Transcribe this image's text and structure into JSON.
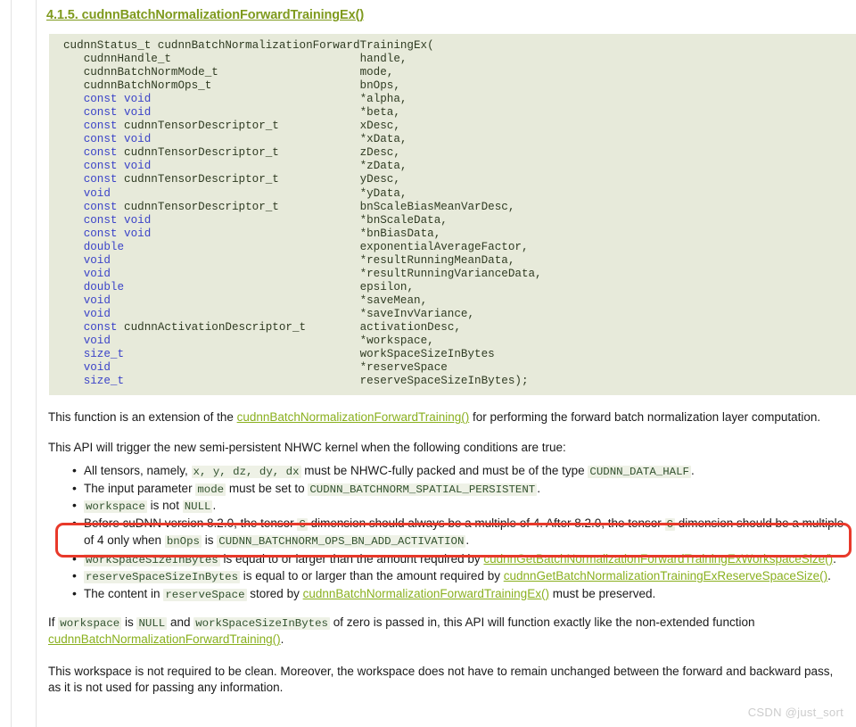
{
  "heading": "4.1.5. cudnnBatchNormalizationForwardTrainingEx()",
  "code": {
    "signature": "cudnnStatus_t cudnnBatchNormalizationForwardTrainingEx(",
    "params": [
      {
        "type_kw": "",
        "type": "cudnnHandle_t",
        "name": "handle,"
      },
      {
        "type_kw": "",
        "type": "cudnnBatchNormMode_t",
        "name": "mode,"
      },
      {
        "type_kw": "",
        "type": "cudnnBatchNormOps_t",
        "name": "bnOps,"
      },
      {
        "type_kw": "const ",
        "type": "void",
        "name": "*alpha,",
        "type_is_kw": true
      },
      {
        "type_kw": "const ",
        "type": "void",
        "name": "*beta,",
        "type_is_kw": true
      },
      {
        "type_kw": "const ",
        "type": "cudnnTensorDescriptor_t",
        "name": "xDesc,"
      },
      {
        "type_kw": "const ",
        "type": "void",
        "name": "*xData,",
        "type_is_kw": true
      },
      {
        "type_kw": "const ",
        "type": "cudnnTensorDescriptor_t",
        "name": "zDesc,"
      },
      {
        "type_kw": "const ",
        "type": "void",
        "name": "*zData,",
        "type_is_kw": true
      },
      {
        "type_kw": "const ",
        "type": "cudnnTensorDescriptor_t",
        "name": "yDesc,"
      },
      {
        "type_kw": "",
        "type": "void",
        "name": "*yData,",
        "type_is_kw": true
      },
      {
        "type_kw": "const ",
        "type": "cudnnTensorDescriptor_t",
        "name": "bnScaleBiasMeanVarDesc,"
      },
      {
        "type_kw": "const ",
        "type": "void",
        "name": "*bnScaleData,",
        "type_is_kw": true
      },
      {
        "type_kw": "const ",
        "type": "void",
        "name": "*bnBiasData,",
        "type_is_kw": true
      },
      {
        "type_kw": "",
        "type": "double",
        "name": "exponentialAverageFactor,",
        "type_is_kw": true
      },
      {
        "type_kw": "",
        "type": "void",
        "name": "*resultRunningMeanData,",
        "type_is_kw": true
      },
      {
        "type_kw": "",
        "type": "void",
        "name": "*resultRunningVarianceData,",
        "type_is_kw": true
      },
      {
        "type_kw": "",
        "type": "double",
        "name": "epsilon,",
        "type_is_kw": true
      },
      {
        "type_kw": "",
        "type": "void",
        "name": "*saveMean,",
        "type_is_kw": true
      },
      {
        "type_kw": "",
        "type": "void",
        "name": "*saveInvVariance,",
        "type_is_kw": true
      },
      {
        "type_kw": "const ",
        "type": "cudnnActivationDescriptor_t",
        "name": "activationDesc,"
      },
      {
        "type_kw": "",
        "type": "void",
        "name": "*workspace,",
        "type_is_kw": true
      },
      {
        "type_kw": "",
        "type": "size_t",
        "name": "workSpaceSizeInBytes",
        "type_is_kw": true
      },
      {
        "type_kw": "",
        "type": "void",
        "name": "*reserveSpace",
        "type_is_kw": true
      },
      {
        "type_kw": "",
        "type": "size_t",
        "name": "reserveSpaceSizeInBytes);",
        "type_is_kw": true
      }
    ]
  },
  "paragraphs": {
    "p1_a": "This function is an extension of the ",
    "p1_link": "cudnnBatchNormalizationForwardTraining()",
    "p1_b": " for performing the forward batch normalization layer computation.",
    "p2": "This API will trigger the new semi-persistent NHWC kernel when the following conditions are true:",
    "p4_a": "If ",
    "p4_code1": "workspace",
    "p4_b": " is ",
    "p4_code2": "NULL",
    "p4_c": " and ",
    "p4_code3": "workSpaceSizeInBytes",
    "p4_d": " of zero is passed in, this API will function exactly like the non-extended function ",
    "p4_link": "cudnnBatchNormalizationForwardTraining()",
    "p4_e": ".",
    "p5": "This workspace is not required to be clean. Moreover, the workspace does not have to remain unchanged between the forward and backward pass, as it is not used for passing any information."
  },
  "bullets": {
    "b1_a": "All tensors, namely, ",
    "b1_code": "x, y, dz, dy, dx",
    "b1_b": " must be NHWC-fully packed and must be of the type ",
    "b1_code2": "CUDNN_DATA_HALF",
    "b1_c": ".",
    "b2_a": "The input parameter ",
    "b2_code": "mode",
    "b2_b": " must be set to ",
    "b2_code2": "CUDNN_BATCHNORM_SPATIAL_PERSISTENT",
    "b2_c": ".",
    "b3_code": "workspace",
    "b3_a": " is not ",
    "b3_code2": "NULL",
    "b3_b": ".",
    "b4_a": "Before cuDNN version 8.2.0, the tensor ",
    "b4_code": "C",
    "b4_b": " dimension should always be a multiple of 4. After 8.2.0, the tensor ",
    "b4_code2": "C",
    "b4_c": " dimension should be a multiple of 4 only when ",
    "b4_code3": "bnOps",
    "b4_d": " is ",
    "b4_code4": "CUDNN_BATCHNORM_OPS_BN_ADD_ACTIVATION",
    "b4_e": ".",
    "b5_code": "workSpaceSizeInBytes",
    "b5_a": " is equal to or larger than the amount required by ",
    "b5_link": "cudnnGetBatchNormalizationForwardTrainingExWorkspaceSize()",
    "b5_b": ".",
    "b6_code": "reserveSpaceSizeInBytes",
    "b6_a": " is equal to or larger than the amount required by ",
    "b6_link": "cudnnGetBatchNormalizationTrainingExReserveSpaceSize()",
    "b6_b": ".",
    "b7_a": "The content in ",
    "b7_code": "reserveSpace",
    "b7_b": " stored by ",
    "b7_link": "cudnnBatchNormalizationForwardTrainingEx()",
    "b7_c": " must be preserved."
  },
  "watermark": "CSDN @just_sort",
  "colors": {
    "link": "#8ab01f",
    "heading": "#7f9a1e",
    "code_bg": "#e7eada",
    "inline_code_bg": "#eef1e6",
    "inline_code_fg": "#32522f",
    "keyword": "#3b43c8",
    "annotation": "#e8392a"
  }
}
